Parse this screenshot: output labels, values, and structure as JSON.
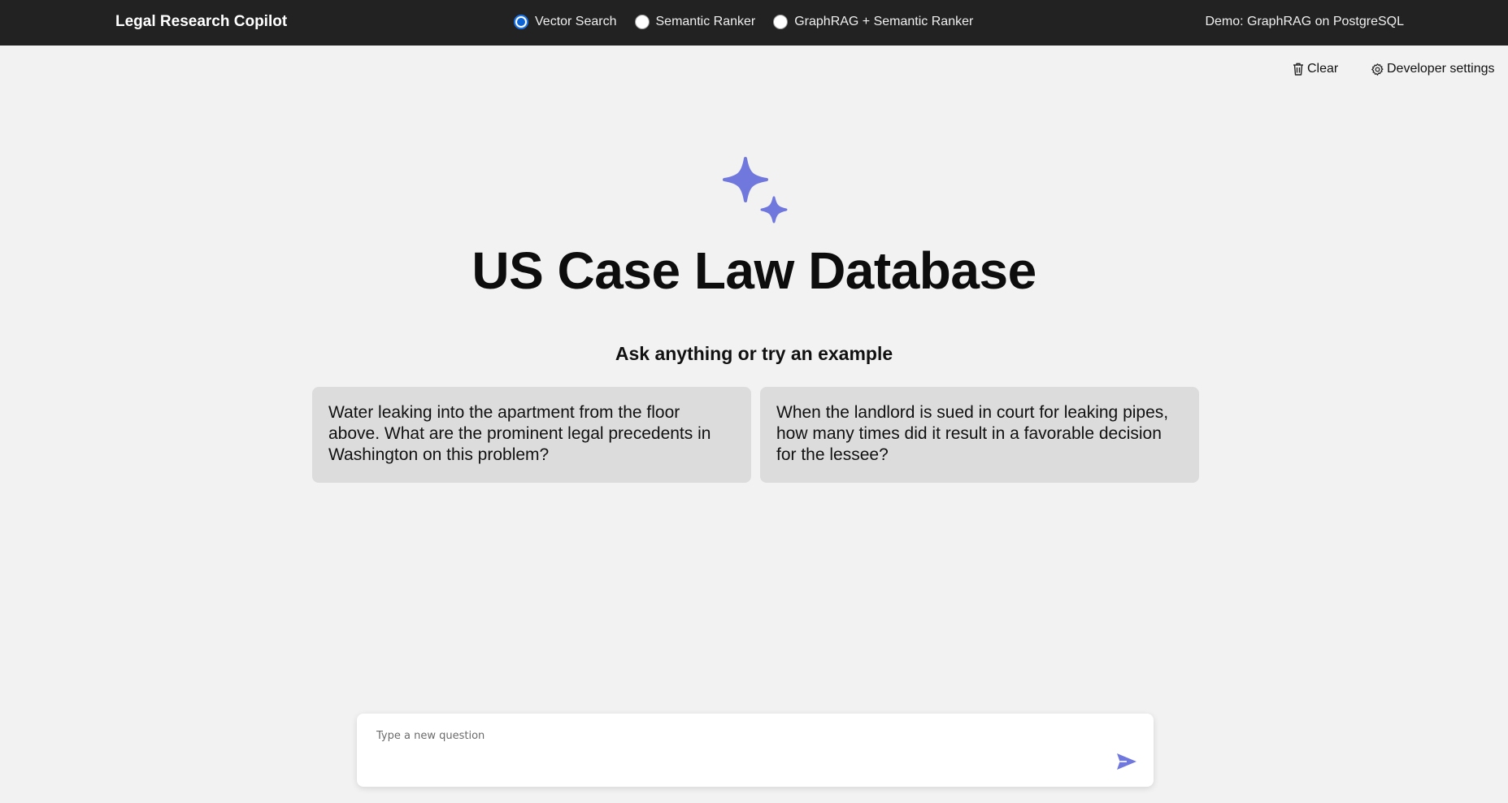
{
  "header": {
    "app_title": "Legal Research Copilot",
    "modes": [
      {
        "label": "Vector Search",
        "selected": true
      },
      {
        "label": "Semantic Ranker",
        "selected": false
      },
      {
        "label": "GraphRAG + Semantic Ranker",
        "selected": false
      }
    ],
    "demo_label": "Demo: GraphRAG on PostgreSQL"
  },
  "commands": {
    "clear_label": "Clear",
    "clear_icon": "trash-icon",
    "settings_label": "Developer settings",
    "settings_icon": "gear-icon"
  },
  "hero": {
    "icon": "sparkle-icon",
    "title": "US Case Law Database",
    "subtitle": "Ask anything or try an example"
  },
  "examples": [
    "Water leaking into the apartment from the floor above. What are the prominent legal precedents in Washington on this problem?",
    "When the landlord is sued in court for leaking pipes, how many times did it result in a favorable decision for the lessee?"
  ],
  "composer": {
    "placeholder": "Type a new question",
    "value": "",
    "send_icon": "send-icon"
  },
  "colors": {
    "accent": "#7078de",
    "topbar": "#222222",
    "background": "#f2f2f2",
    "card": "#dcdcdc",
    "radio_selected": "#0b63d6"
  }
}
